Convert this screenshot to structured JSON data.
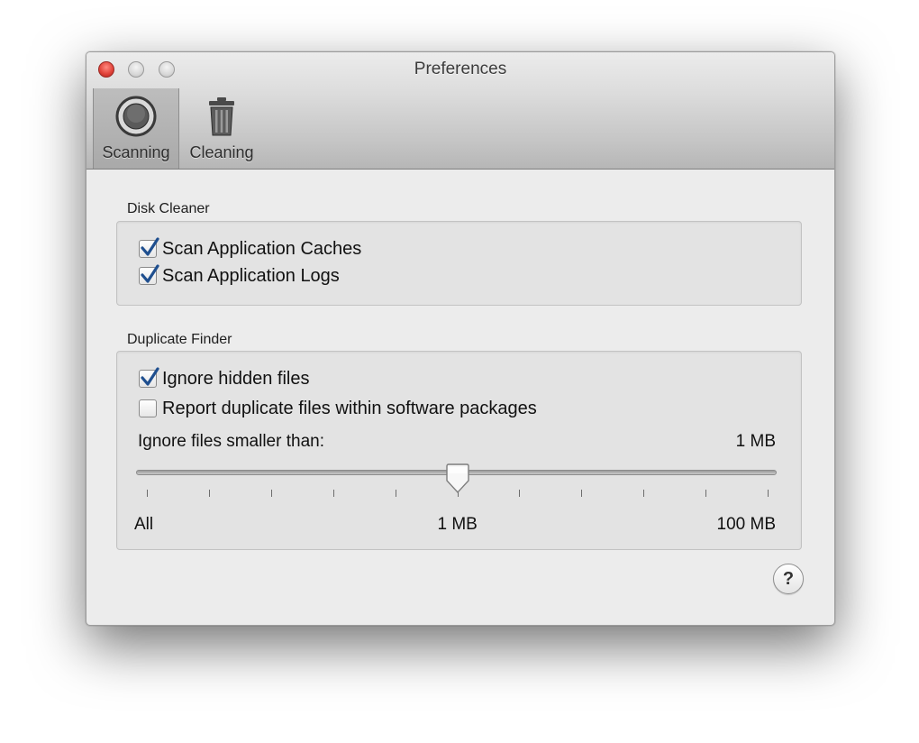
{
  "window": {
    "title": "Preferences"
  },
  "toolbar": {
    "tabs": [
      {
        "label": "Scanning",
        "icon": "scanning-icon",
        "selected": true
      },
      {
        "label": "Cleaning",
        "icon": "trash-icon",
        "selected": false
      }
    ]
  },
  "disk_cleaner": {
    "title": "Disk Cleaner",
    "options": [
      {
        "label": "Scan Application Caches",
        "checked": true
      },
      {
        "label": "Scan Application Logs",
        "checked": true
      }
    ]
  },
  "duplicate_finder": {
    "title": "Duplicate Finder",
    "options": [
      {
        "label": "Ignore hidden files",
        "checked": true
      },
      {
        "label": "Report duplicate files within software packages",
        "checked": false
      }
    ],
    "size_label": "Ignore files smaller than:",
    "size_value": "1 MB",
    "slider": {
      "min_label": "All",
      "mid_label": "1 MB",
      "max_label": "100 MB",
      "value_fraction": 0.5,
      "tick_count": 11
    }
  },
  "help": {
    "label": "?"
  },
  "colors": {
    "close_button": "#e2453c",
    "checkmark": "#1f4f8f"
  }
}
